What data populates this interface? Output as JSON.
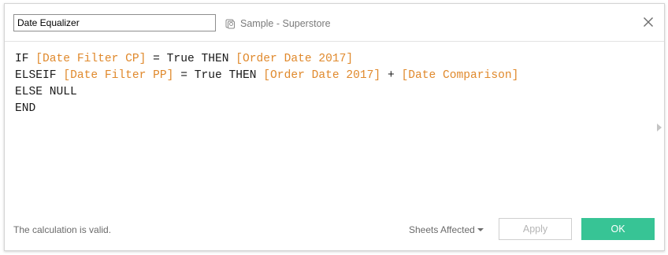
{
  "header": {
    "calc_name": "Date Equalizer",
    "datasource_label": "Sample - Superstore",
    "datasource_icon": "datasource-icon",
    "close_icon": "close-icon"
  },
  "editor": {
    "lines": [
      [
        {
          "text": "IF ",
          "kind": "keyword"
        },
        {
          "text": "[Date Filter CP]",
          "kind": "field"
        },
        {
          "text": " = True THEN ",
          "kind": "keyword"
        },
        {
          "text": "[Order Date 2017]",
          "kind": "field"
        }
      ],
      [
        {
          "text": "ELSEIF ",
          "kind": "keyword"
        },
        {
          "text": "[Date Filter PP]",
          "kind": "field"
        },
        {
          "text": " = True THEN ",
          "kind": "keyword"
        },
        {
          "text": "[Order Date 2017]",
          "kind": "field"
        },
        {
          "text": " + ",
          "kind": "keyword"
        },
        {
          "text": "[Date Comparison]",
          "kind": "field"
        }
      ],
      [
        {
          "text": "ELSE NULL",
          "kind": "keyword"
        }
      ],
      [
        {
          "text": "END",
          "kind": "keyword"
        }
      ]
    ],
    "colors": {
      "keyword": "#1a1a1a",
      "field": "#e0892c"
    }
  },
  "footer": {
    "status": "The calculation is valid.",
    "sheets_affected": "Sheets Affected",
    "apply_label": "Apply",
    "ok_label": "OK"
  },
  "colors": {
    "ok_button": "#37c495",
    "apply_text_disabled": "#b5b5b5"
  }
}
